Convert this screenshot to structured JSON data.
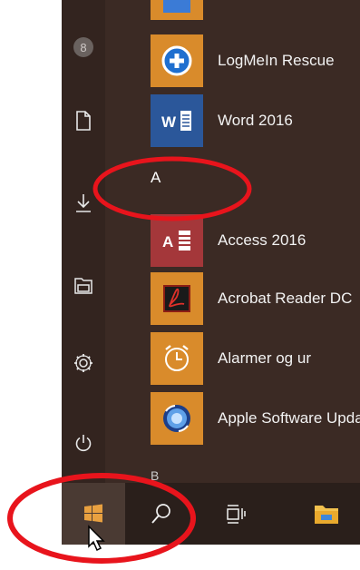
{
  "start_menu": {
    "apps": [
      {
        "label": "LogMeIn Rescue",
        "icon": "logmein-rescue-icon",
        "tile_color": "#d98b2b"
      },
      {
        "label": "Word 2016",
        "icon": "word-icon",
        "tile_color": "#2b579a"
      },
      {
        "label": "Access 2016",
        "icon": "access-icon",
        "tile_color": "#a4373a"
      },
      {
        "label": "Acrobat Reader DC",
        "icon": "acrobat-icon",
        "tile_color": "#d98b2b"
      },
      {
        "label": "Alarmer og ur",
        "icon": "alarm-clock-icon",
        "tile_color": "#d98b2b"
      },
      {
        "label": "Apple Software Update",
        "icon": "apple-software-update-icon",
        "tile_color": "#d98b2b"
      }
    ],
    "group_letter_a": "A",
    "group_letter_b": "B",
    "rail": {
      "avatar_initial": "8"
    }
  },
  "annotation_color": "#e8141c"
}
